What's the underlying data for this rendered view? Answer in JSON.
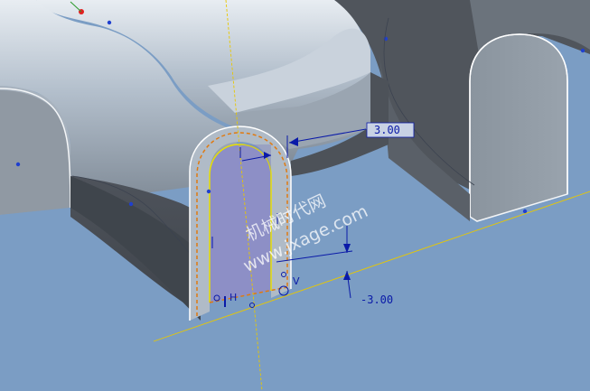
{
  "viewport": {
    "background_color": "#7b9dc4",
    "surface_color": "#a9b6c4",
    "shadow_color": "#555a62",
    "sketch_fill_color": "#8d8fc6",
    "dimension_color": "#0a1aa8",
    "reference_line_color": "#e8c800",
    "sketch_outline_color": "#e07a10"
  },
  "dimensions": {
    "upper": "3.00",
    "lower": "-3.00"
  },
  "symbols": {
    "horizontal": "H",
    "vertical": "V"
  },
  "watermark": {
    "line1": "机械时代网",
    "line2": "www.jxage.com"
  }
}
